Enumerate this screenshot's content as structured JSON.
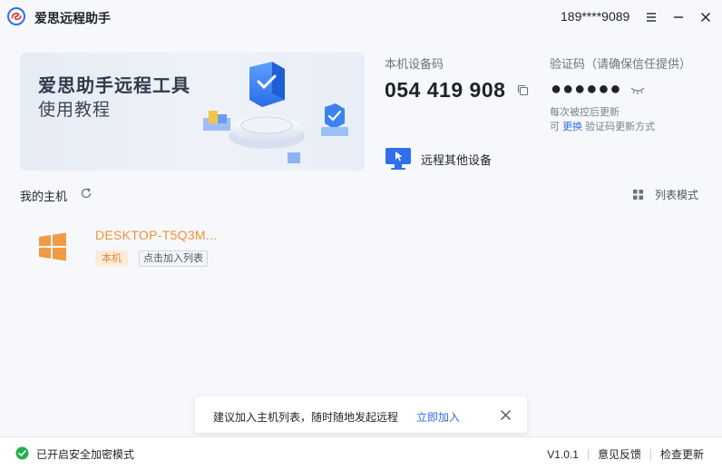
{
  "app": {
    "title": "爱思远程助手",
    "user_id": "189****9089"
  },
  "banner": {
    "title": "爱思助手远程工具",
    "subtitle": "使用教程"
  },
  "device_code": {
    "label": "本机设备码",
    "value": "054 419 908"
  },
  "verify_code": {
    "label": "验证码（请确保信任提供）",
    "masked": "●●●●●●",
    "note_line1": "每次被控后更新",
    "note_prefix": "可",
    "note_link": "更换",
    "note_suffix": "验证码更新方式"
  },
  "remote_other": {
    "label": "远程其他设备"
  },
  "hosts": {
    "section_title": "我的主机",
    "view_mode_label": "列表模式",
    "items": [
      {
        "name": "DESKTOP-T5Q3M...",
        "tag_local": "本机",
        "tag_add": "点击加入列表"
      }
    ]
  },
  "toast": {
    "message": "建议加入主机列表，随时随地发起远程",
    "action": "立即加入"
  },
  "status": {
    "secure_mode": "已开启安全加密模式",
    "version": "V1.0.1",
    "feedback": "意见反馈",
    "check_update": "检查更新"
  },
  "colors": {
    "accent_blue": "#2f6fed",
    "host_orange": "#f0913a",
    "secure_green": "#1fb04d"
  }
}
